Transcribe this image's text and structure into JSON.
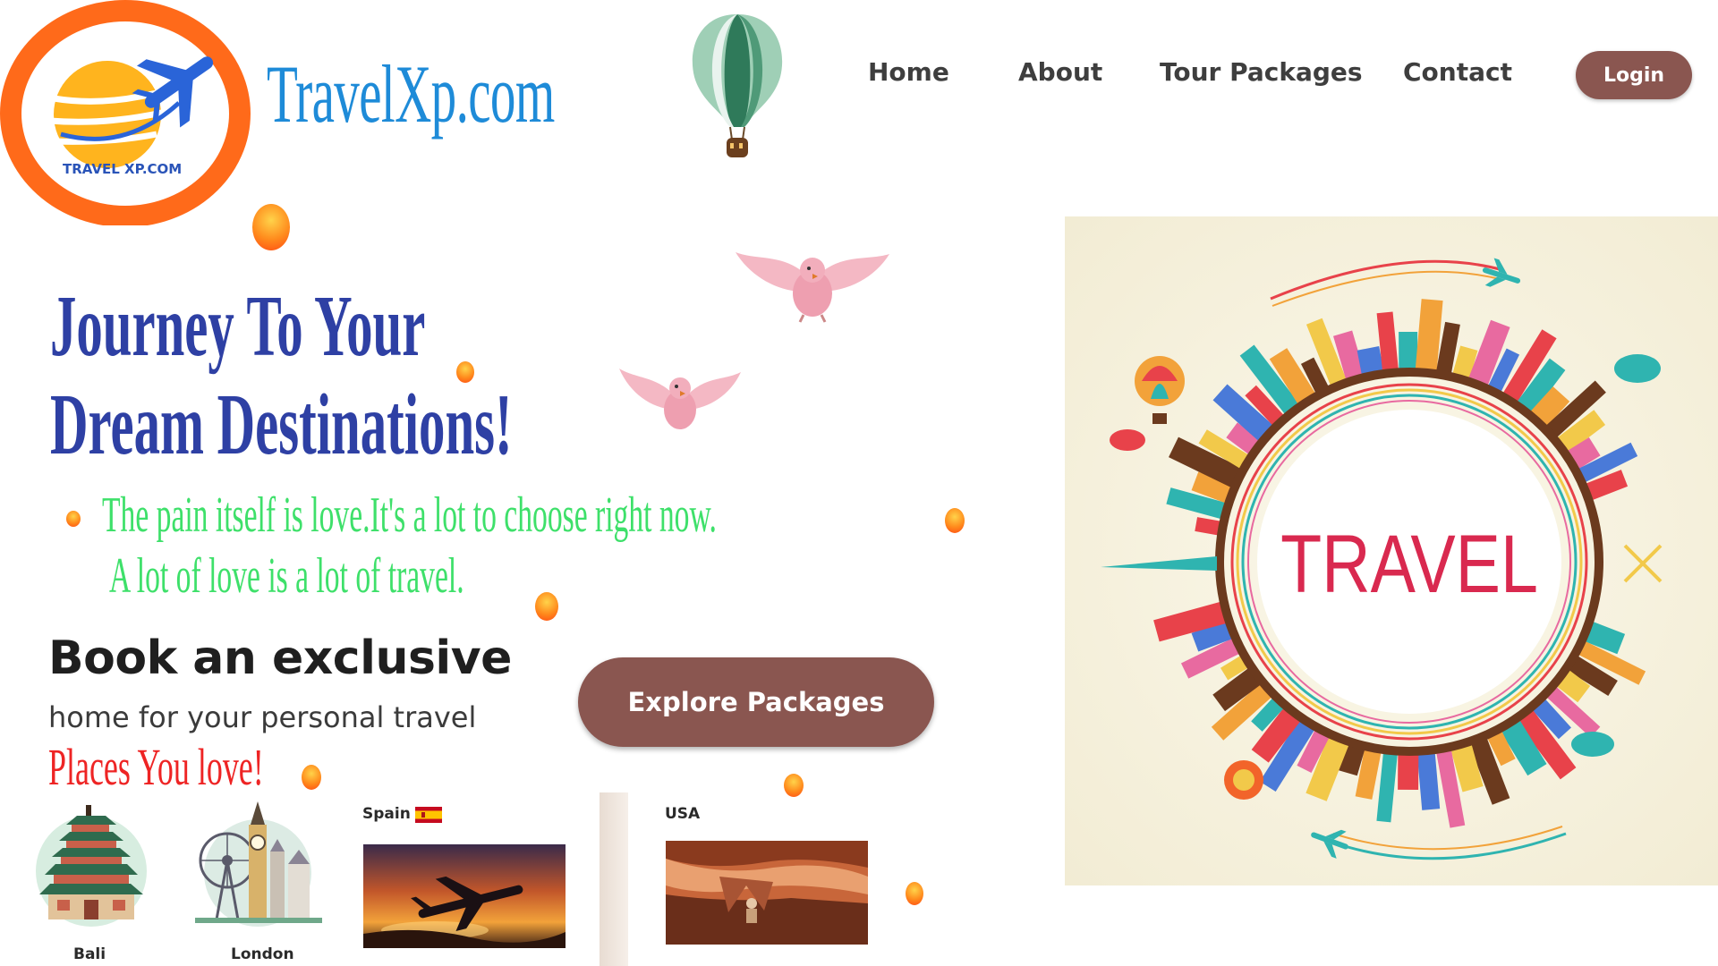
{
  "logo": {
    "badge_text": "TRAVEL XP.COM"
  },
  "site": {
    "title": "TravelXp.com"
  },
  "nav": {
    "items": [
      {
        "label": "Home"
      },
      {
        "label": "About"
      },
      {
        "label": "Tour Packages"
      },
      {
        "label": "Contact"
      }
    ],
    "login_label": "Login"
  },
  "hero": {
    "headline_line1": "Journey To Your",
    "headline_line2": "Dream Destinations!",
    "tagline_line1": "The pain itself is love.It's a lot to choose right now.",
    "tagline_line2": "A lot of love is a lot of travel."
  },
  "booking": {
    "title": "Book an exclusive",
    "subtitle": "home for your personal travel",
    "places": "Places You love!",
    "explore_label": "Explore Packages"
  },
  "destinations": [
    {
      "name": "Bali"
    },
    {
      "name": "London"
    },
    {
      "name": "Spain",
      "icon": "spain-flag-icon"
    },
    {
      "name": "USA"
    }
  ],
  "travel_card": {
    "text": "TRAVEL"
  },
  "colors": {
    "brand_blue": "#1e8bd8",
    "headline_blue": "#2e40a4",
    "tagline_green": "#3ee06a",
    "places_red": "#ee2424",
    "button_brown": "#8a5650",
    "logo_orange": "#ff6a1a",
    "travel_red": "#d9294f"
  }
}
